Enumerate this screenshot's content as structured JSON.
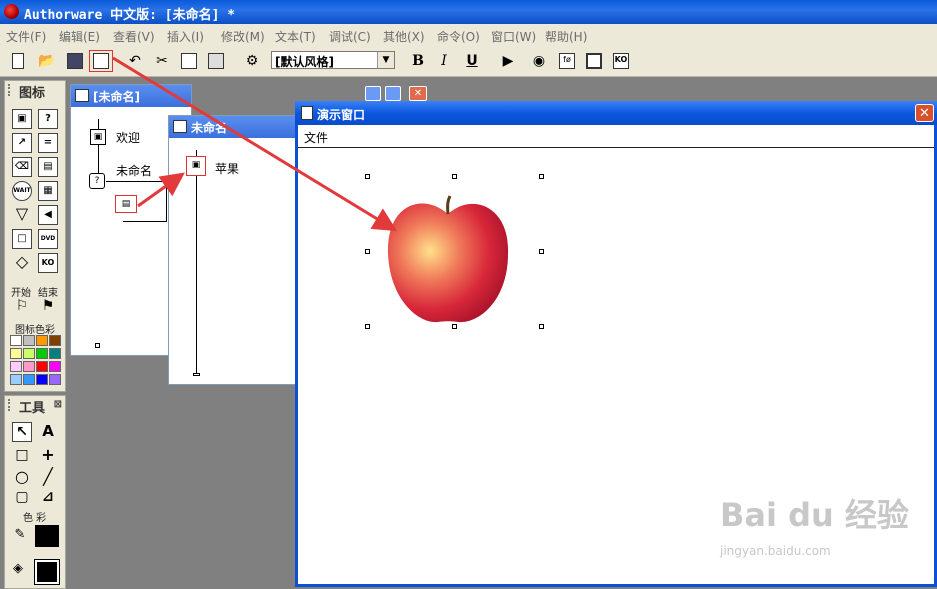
{
  "app": {
    "title": "Authorware 中文版: [未命名] *"
  },
  "menu": [
    {
      "label": "文件(F)"
    },
    {
      "label": "编辑(E)"
    },
    {
      "label": "查看(V)"
    },
    {
      "label": "插入(I)"
    },
    {
      "label": "修改(M)"
    },
    {
      "label": "文本(T)"
    },
    {
      "label": "调试(C)"
    },
    {
      "label": "其他(X)"
    },
    {
      "label": "命令(O)"
    },
    {
      "label": "窗口(W)"
    },
    {
      "label": "帮助(H)"
    }
  ],
  "toolbar": {
    "style_value": "[默认风格]",
    "bold_label": "B",
    "italic_label": "I",
    "underline_label": "U",
    "icons": [
      "new-file-icon",
      "open-folder-icon",
      "save-all-icon",
      "import-icon",
      "undo-icon",
      "cut-icon",
      "copy-icon",
      "paste-icon",
      "find-icon",
      "restart-icon",
      "restart-from-flag-icon",
      "function-window-icon",
      "variable-window-icon",
      "knowledge-object-icon"
    ]
  },
  "palette": {
    "title": "图标",
    "icons": [
      "display-icon",
      "motion-icon",
      "erase-icon",
      "wait-icon",
      "navigate-icon",
      "framework-icon",
      "decision-icon",
      "interaction-icon",
      "calculation-icon",
      "map-icon",
      "digital-movie-icon",
      "sound-icon",
      "video-icon",
      "dvd-icon",
      "knowledge-object-icon"
    ],
    "wait_label": "WAIT",
    "dvd_label": "DVD",
    "ko_label": "KO",
    "start_label": "开始",
    "end_label": "结束",
    "color_label": "图标色彩",
    "colors": [
      "#ffffff",
      "#c0c0c0",
      "#ff9900",
      "#804000",
      "#ffff99",
      "#ccff66",
      "#00cc00",
      "#008080",
      "#ffccff",
      "#ff99cc",
      "#ff0000",
      "#ff00ff",
      "#99ccff",
      "#3399ff",
      "#0000ff",
      "#9966ff"
    ]
  },
  "tools": {
    "title": "工具",
    "color_section_label": "色 彩",
    "pointer_label": "↖",
    "text_label": "A"
  },
  "win1": {
    "title": "[未命名]",
    "items": [
      {
        "label": "欢迎"
      },
      {
        "label": "未命名"
      }
    ]
  },
  "win2": {
    "title": "未命名",
    "items": [
      {
        "label": "苹果"
      }
    ]
  },
  "presentation": {
    "title": "演示窗口",
    "menu_file": "文件",
    "close_label": "✕"
  },
  "watermark": {
    "brand": "Bai du 经验",
    "url": "jingyan.baidu.com"
  },
  "accents": {
    "arrow": "#e23a3a",
    "caption_blue": "#0c58e0"
  }
}
